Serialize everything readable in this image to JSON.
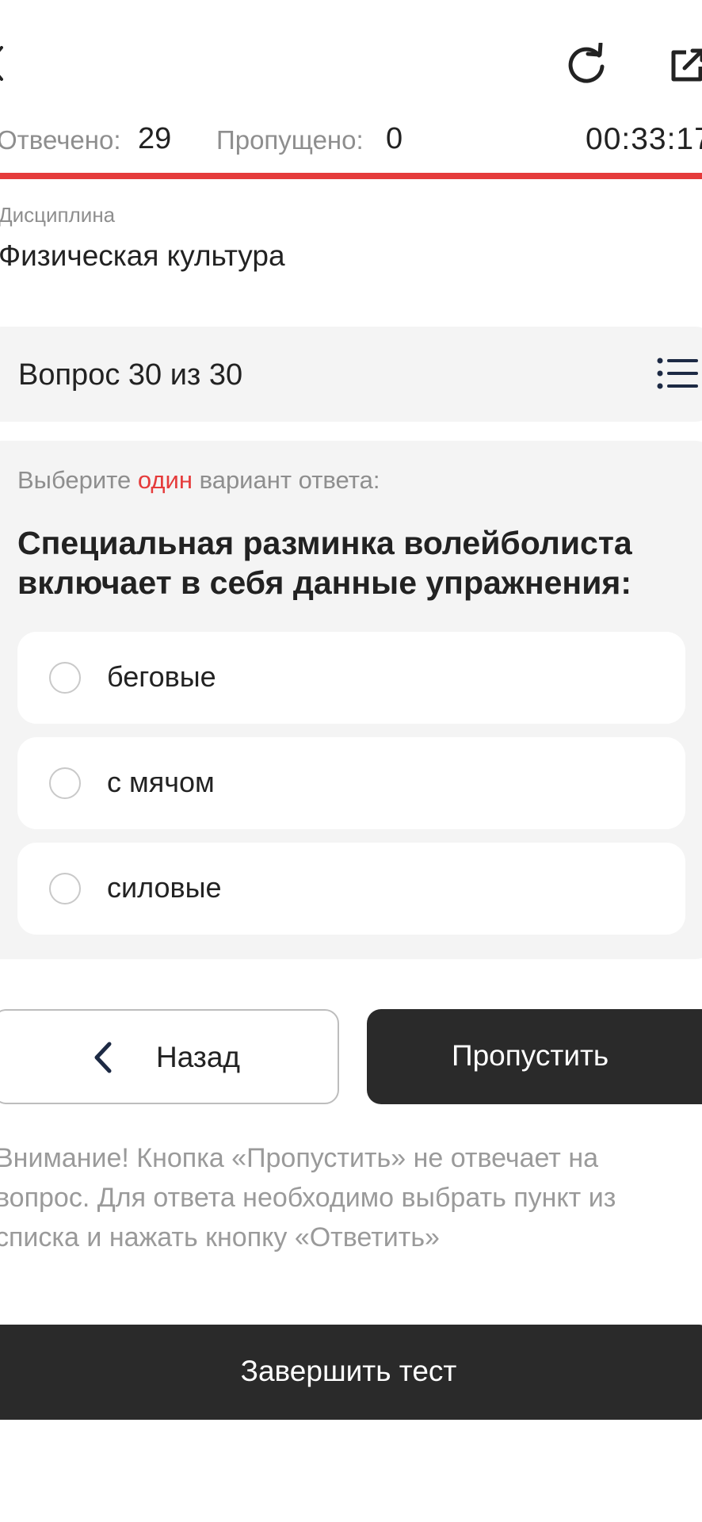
{
  "header": {
    "icons": {
      "back": "chevron-left-icon",
      "refresh": "refresh-icon",
      "share": "external-link-icon"
    },
    "answered_label": "Отвечено:",
    "answered_value": "29",
    "skipped_label": "Пропущено:",
    "skipped_value": "0",
    "timer": "00:33:17",
    "progress_fraction": 1.0,
    "accent_color": "#e53b3b"
  },
  "discipline": {
    "label": "Дисциплина",
    "value": "Физическая культура"
  },
  "question_nav": {
    "title": "Вопрос 30 из 30",
    "list_icon": "list-icon"
  },
  "question": {
    "instruction_prefix": "Выберите ",
    "instruction_accent": "один",
    "instruction_suffix": " вариант ответа:",
    "text": "Специальная разминка волейболиста включает в себя данные упражнения:",
    "options": [
      {
        "label": "беговые",
        "selected": false
      },
      {
        "label": "с мячом",
        "selected": false
      },
      {
        "label": "силовые",
        "selected": false
      }
    ]
  },
  "buttons": {
    "back_label": "Назад",
    "skip_label": "Пропустить",
    "finish_label": "Завершить тест"
  },
  "warning": "Внимание! Кнопка «Пропустить» не отвечает на вопрос. Для ответа необходимо выбрать пункт из списка и нажать кнопку «Ответить»"
}
